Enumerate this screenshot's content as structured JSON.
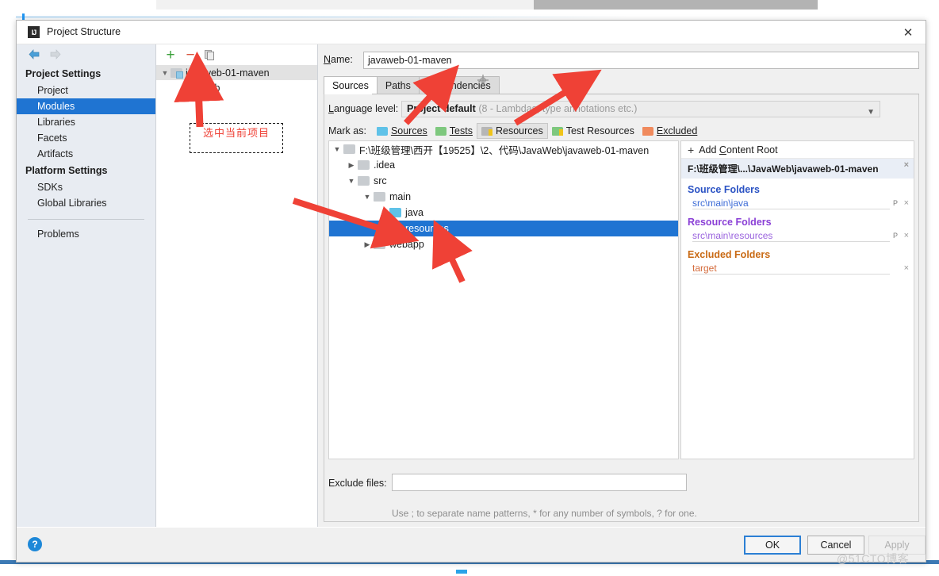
{
  "window": {
    "title": "Project Structure",
    "app_icon": "IJ",
    "close_icon": "close-icon"
  },
  "nav": {
    "back_icon": "arrow-left-icon",
    "forward_icon": "arrow-right-icon",
    "groups": [
      {
        "label": "Project Settings",
        "items": [
          {
            "label": "Project",
            "selected": false
          },
          {
            "label": "Modules",
            "selected": true
          },
          {
            "label": "Libraries",
            "selected": false
          },
          {
            "label": "Facets",
            "selected": false
          },
          {
            "label": "Artifacts",
            "selected": false
          }
        ]
      },
      {
        "label": "Platform Settings",
        "items": [
          {
            "label": "SDKs",
            "selected": false
          },
          {
            "label": "Global Libraries",
            "selected": false
          }
        ]
      }
    ],
    "problems": "Problems"
  },
  "modules": {
    "toolbar": {
      "add": "+",
      "remove": "−",
      "copy": "copy-icon"
    },
    "tree": [
      {
        "label": "javaweb-01-maven",
        "icon": "module-folder-icon",
        "expanded": true,
        "selected": true
      },
      {
        "label": "Web",
        "icon": "web-facet-icon",
        "child": true
      }
    ],
    "annotation": "选中当前项目"
  },
  "detail": {
    "name_label": "Name:",
    "name_value": "javaweb-01-maven",
    "tabs": [
      {
        "label": "Sources",
        "active": true
      },
      {
        "label": "Paths",
        "active": false
      },
      {
        "label": "Dependencies",
        "active": false
      }
    ],
    "tab_add_icon": "crosshair-add-icon",
    "language_level": {
      "label": "Language level:",
      "value_strong": "Project default",
      "value_dim": "(8 - Lambdas, type annotations etc.)",
      "caret_icon": "chevron-down-icon"
    },
    "mark_as": {
      "label": "Mark as:",
      "buttons": [
        {
          "label": "Sources",
          "icon": "folder-sources-icon",
          "pressed": false
        },
        {
          "label": "Tests",
          "icon": "folder-tests-icon",
          "pressed": false
        },
        {
          "label": "Resources",
          "icon": "folder-resources-icon",
          "pressed": true
        },
        {
          "label": "Test Resources",
          "icon": "folder-test-resources-icon",
          "pressed": false
        },
        {
          "label": "Excluded",
          "icon": "folder-excluded-icon",
          "pressed": false
        }
      ]
    },
    "tree": [
      {
        "label": "F:\\班级管理\\西开【19525】\\2、代码\\JavaWeb\\javaweb-01-maven",
        "indent": 0,
        "arrow": "v",
        "icon": "folder-plain-icon",
        "selected": false
      },
      {
        "label": ".idea",
        "indent": 1,
        "arrow": ">",
        "icon": "folder-plain-icon",
        "selected": false
      },
      {
        "label": "src",
        "indent": 1,
        "arrow": "v",
        "icon": "folder-plain-icon",
        "selected": false
      },
      {
        "label": "main",
        "indent": 2,
        "arrow": "v",
        "icon": "folder-plain-icon",
        "selected": false
      },
      {
        "label": "java",
        "indent": 3,
        "arrow": "",
        "icon": "folder-sources-icon",
        "selected": false
      },
      {
        "label": "resources",
        "indent": 3,
        "arrow": "",
        "icon": "folder-resources-icon",
        "selected": true
      },
      {
        "label": "webapp",
        "indent": 2,
        "arrow": ">",
        "icon": "folder-plain-icon",
        "selected": false
      }
    ],
    "roots": {
      "add_content_root": "Add Content Root",
      "add_icon": "plus-icon",
      "content_root_path": "F:\\班级管理\\...\\JavaWeb\\javaweb-01-maven",
      "groups": [
        {
          "title": "Source Folders",
          "kind": "source",
          "items": [
            {
              "path": "src\\main\\java",
              "prefix_marker": "P",
              "close_marker": "×"
            }
          ]
        },
        {
          "title": "Resource Folders",
          "kind": "resource",
          "items": [
            {
              "path": "src\\main\\resources",
              "prefix_marker": "P",
              "close_marker": "×"
            }
          ]
        },
        {
          "title": "Excluded Folders",
          "kind": "excluded",
          "items": [
            {
              "path": "target",
              "prefix_marker": "",
              "close_marker": "×"
            }
          ]
        }
      ]
    },
    "exclude_files": {
      "label": "Exclude files:",
      "value": "",
      "hint": "Use ; to separate name patterns, * for any number of symbols, ? for one."
    }
  },
  "footer": {
    "help_icon": "help-icon",
    "ok": "OK",
    "cancel": "Cancel",
    "apply": "Apply"
  },
  "watermark": "@51CTO博客"
}
